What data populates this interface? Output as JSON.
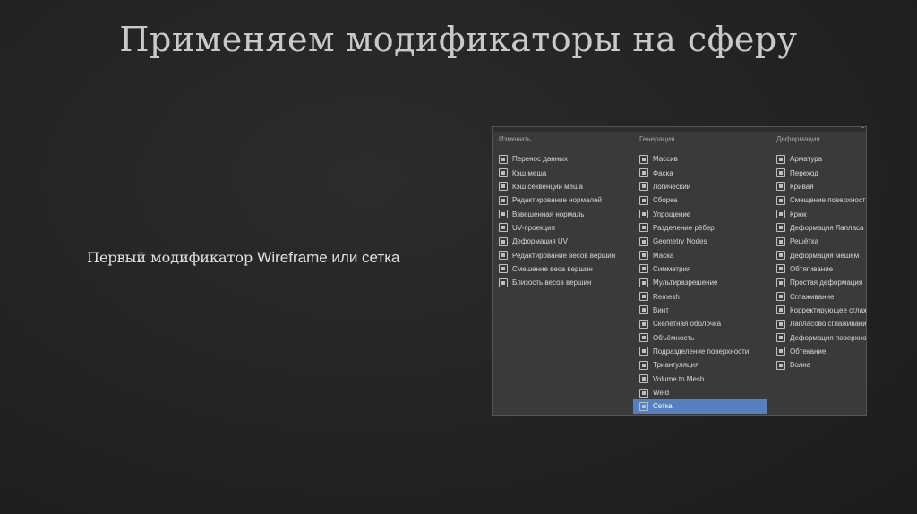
{
  "slide": {
    "title": "Применяем модификаторы на сферу",
    "caption_ru": "Первый модификатор ",
    "caption_latin": "Wireframe или сетка"
  },
  "menu": {
    "columns": [
      {
        "header": "Изменить",
        "items": [
          {
            "label": "Перенос данных",
            "icon": "data-transfer-icon"
          },
          {
            "label": "Кэш меша",
            "icon": "mesh-cache-icon"
          },
          {
            "label": "Кэш секвенции меша",
            "icon": "mesh-sequence-cache-icon"
          },
          {
            "label": "Редактирование нормалей",
            "icon": "normal-edit-icon"
          },
          {
            "label": "Взвешенная нормаль",
            "icon": "weighted-normal-icon"
          },
          {
            "label": "UV-проекция",
            "icon": "uv-project-icon"
          },
          {
            "label": "Деформация UV",
            "icon": "uv-warp-icon"
          },
          {
            "label": "Редактирование весов вершин",
            "icon": "vertex-weight-edit-icon"
          },
          {
            "label": "Смешение веса вершин",
            "icon": "vertex-weight-mix-icon"
          },
          {
            "label": "Близость весов вершин",
            "icon": "vertex-weight-proximity-icon"
          }
        ]
      },
      {
        "header": "Генерация",
        "items": [
          {
            "label": "Массив",
            "icon": "array-icon"
          },
          {
            "label": "Фаска",
            "icon": "bevel-icon"
          },
          {
            "label": "Логический",
            "icon": "boolean-icon"
          },
          {
            "label": "Сборка",
            "icon": "build-icon"
          },
          {
            "label": "Упрощение",
            "icon": "decimate-icon"
          },
          {
            "label": "Разделение рёбер",
            "icon": "edge-split-icon"
          },
          {
            "label": "Geometry Nodes",
            "icon": "geometry-nodes-icon"
          },
          {
            "label": "Маска",
            "icon": "mask-icon"
          },
          {
            "label": "Симметрия",
            "icon": "mirror-icon"
          },
          {
            "label": "Мультиразрешение",
            "icon": "multires-icon"
          },
          {
            "label": "Remesh",
            "icon": "remesh-icon"
          },
          {
            "label": "Винт",
            "icon": "screw-icon"
          },
          {
            "label": "Скелетная оболочка",
            "icon": "skin-icon"
          },
          {
            "label": "Объёмность",
            "icon": "solidify-icon"
          },
          {
            "label": "Подразделение поверхности",
            "icon": "subsurf-icon"
          },
          {
            "label": "Триангуляция",
            "icon": "triangulate-icon"
          },
          {
            "label": "Volume to Mesh",
            "icon": "volume-to-mesh-icon"
          },
          {
            "label": "Weld",
            "icon": "weld-icon"
          },
          {
            "label": "Сетка",
            "icon": "wireframe-icon",
            "selected": true
          }
        ]
      },
      {
        "header": "Деформация",
        "items": [
          {
            "label": "Арматура",
            "icon": "armature-icon"
          },
          {
            "label": "Переход",
            "icon": "cast-icon"
          },
          {
            "label": "Кривая",
            "icon": "curve-icon"
          },
          {
            "label": "Смещение поверхности",
            "icon": "displace-icon"
          },
          {
            "label": "Крюк",
            "icon": "hook-icon"
          },
          {
            "label": "Деформация Лапласа",
            "icon": "laplacian-deform-icon"
          },
          {
            "label": "Решётка",
            "icon": "lattice-icon"
          },
          {
            "label": "Деформация мешем",
            "icon": "mesh-deform-icon"
          },
          {
            "label": "Обтягивание",
            "icon": "shrinkwrap-icon"
          },
          {
            "label": "Простая деформация",
            "icon": "simple-deform-icon"
          },
          {
            "label": "Сглаживание",
            "icon": "smooth-icon"
          },
          {
            "label": "Корректирующее сглаж",
            "icon": "corrective-smooth-icon"
          },
          {
            "label": "Лапласово сглаживани",
            "icon": "laplacian-smooth-icon"
          },
          {
            "label": "Деформация поверхнос",
            "icon": "surface-deform-icon"
          },
          {
            "label": "Обтекание",
            "icon": "warp-icon"
          },
          {
            "label": "Волна",
            "icon": "wave-icon"
          }
        ]
      }
    ],
    "selected_color": "#5680c2"
  }
}
